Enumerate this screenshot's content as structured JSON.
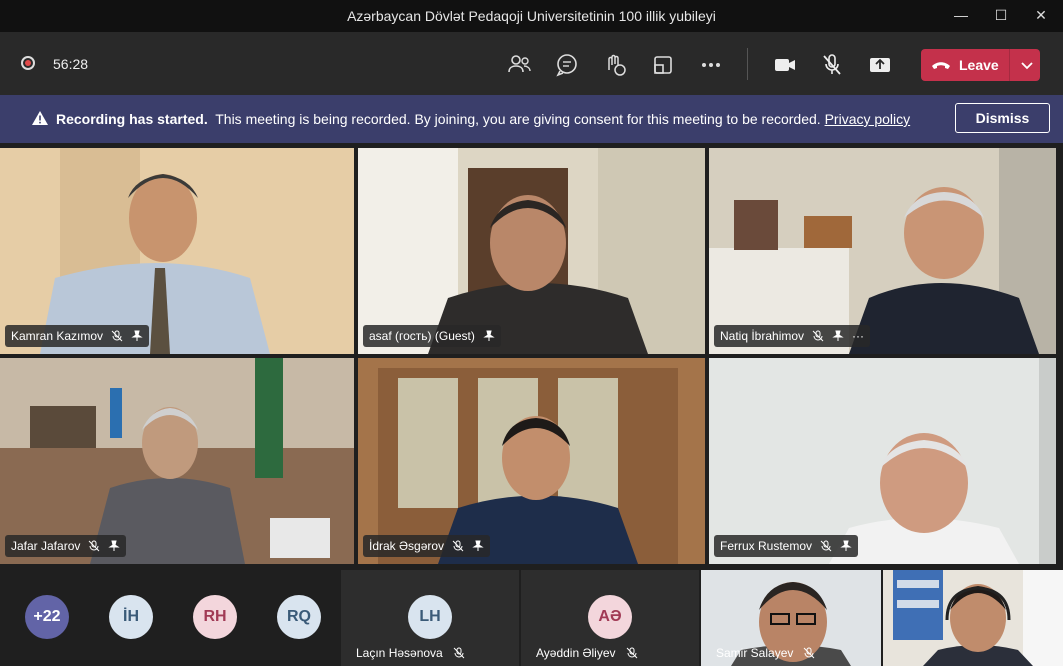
{
  "window": {
    "title": "Azərbaycan Dövlət Pedaqoji Universitetinin 100 illik yubileyi",
    "minimize_glyph": "—",
    "maximize_glyph": "☐",
    "close_glyph": "✕"
  },
  "toolbar": {
    "timer": "56:28",
    "leave_label": "Leave",
    "icons": [
      "participants-icon",
      "chat-icon",
      "reactions-icon",
      "share-tray-icon",
      "more-icon",
      "camera-icon",
      "mic-muted-icon",
      "share-screen-icon"
    ],
    "leave_color": "#c4314b"
  },
  "banner": {
    "title": "Recording has started.",
    "message": "This meeting is being recorded. By joining, you are giving consent for this meeting to be recorded.",
    "link": "Privacy policy",
    "dismiss_label": "Dismiss",
    "color": "#3b3e6b"
  },
  "participants": [
    {
      "name": "Kamran Kazımov",
      "muted": true,
      "pinned": true
    },
    {
      "name": "asaf (гость) (Guest)",
      "muted": false,
      "pinned": true
    },
    {
      "name": "Natiq İbrahimov",
      "muted": true,
      "pinned": true,
      "more": "···"
    },
    {
      "name": "Jafar Jafarov",
      "muted": true,
      "pinned": true
    },
    {
      "name": "İdrak Əsgərov",
      "muted": true,
      "pinned": true
    },
    {
      "name": "Ferrux Rustemov",
      "muted": true,
      "pinned": true
    }
  ],
  "bottom_row": {
    "overflow": "+22",
    "avatars": [
      {
        "initials": "İH",
        "bg": "#d9e4ef",
        "fg": "#3a5a78"
      },
      {
        "initials": "RH",
        "bg": "#f3d6dc",
        "fg": "#a13a55"
      },
      {
        "initials": "RQ",
        "bg": "#d9e4ef",
        "fg": "#3a5a78"
      }
    ],
    "tiles": [
      {
        "initials": "LH",
        "name": "Laçın Həsənova",
        "bg": "#d9e4ef",
        "fg": "#3a5a78"
      },
      {
        "initials": "AƏ",
        "name": "Ayəddin Əliyev",
        "bg": "#f3d6dc",
        "fg": "#a13a55"
      },
      {
        "name": "Samir Salayev"
      }
    ]
  }
}
